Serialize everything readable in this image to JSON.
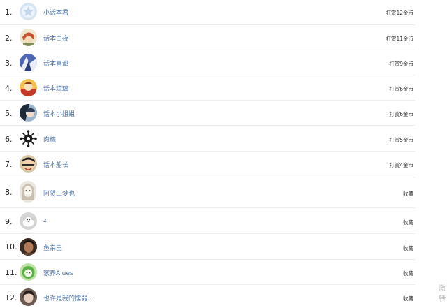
{
  "rankings": [
    {
      "rank": "1.",
      "name": "小话本君",
      "reward": "打赏12金币",
      "avatar_icon": "star-badge-icon"
    },
    {
      "rank": "2.",
      "name": "话本白夜",
      "reward": "打赏11金币",
      "avatar_icon": "anime-character-icon"
    },
    {
      "rank": "3.",
      "name": "话本喜都",
      "reward": "打赏9金币",
      "avatar_icon": "anime-character-icon"
    },
    {
      "rank": "4.",
      "name": "话本琼璃",
      "reward": "打赏6金币",
      "avatar_icon": "anime-character-icon"
    },
    {
      "rank": "5.",
      "name": "话本小姐姐",
      "reward": "打赏6金币",
      "avatar_icon": "anime-character-icon"
    },
    {
      "rank": "6.",
      "name": "肉粽",
      "reward": "打赏5金币",
      "avatar_icon": "virus-graphic-icon"
    },
    {
      "rank": "7.",
      "name": "话本船长",
      "reward": "打赏4金币",
      "avatar_icon": "luffy-character-icon"
    },
    {
      "rank": "8.",
      "name": "阿贺三梦也",
      "reward": "收藏",
      "avatar_icon": "sketch-character-icon"
    },
    {
      "rank": "9.",
      "name": "z",
      "reward": "收藏",
      "avatar_icon": "white-dog-icon"
    },
    {
      "rank": "10.",
      "name": "鱼亲王",
      "reward": "收藏",
      "avatar_icon": "man-portrait-icon"
    },
    {
      "rank": "11.",
      "name": "家养Alues",
      "reward": "收藏",
      "avatar_icon": "green-character-icon"
    },
    {
      "rank": "12.",
      "name": "也许是我的懦弱...",
      "reward": "收藏",
      "avatar_icon": "person-photo-icon"
    }
  ],
  "edge_text": [
    "激",
    "转"
  ]
}
